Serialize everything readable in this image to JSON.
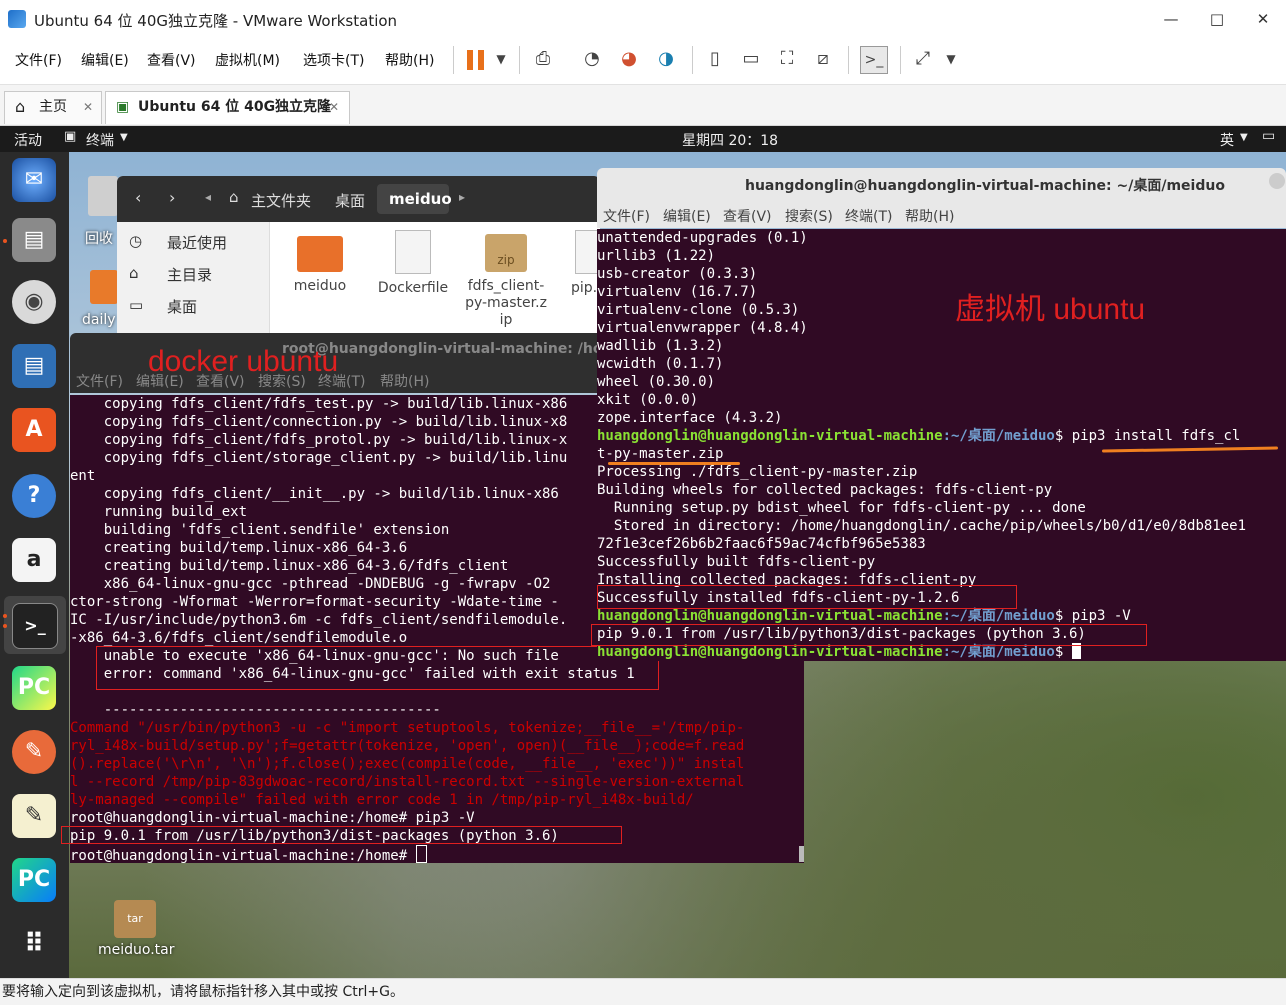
{
  "window": {
    "title": "Ubuntu 64 位 40G独立克隆 - VMware Workstation",
    "controls": [
      "—",
      "□",
      "✕"
    ]
  },
  "menubar": [
    "文件(F)",
    "编辑(E)",
    "查看(V)",
    "虚拟机(M)",
    "选项卡(T)",
    "帮助(H)"
  ],
  "tabs": [
    {
      "label": "主页"
    },
    {
      "label": "Ubuntu 64 位 40G独立克隆"
    }
  ],
  "ubuntu_topbar": {
    "activities": "活动",
    "app": "终端",
    "clock": "星期四 20：18",
    "ime": "英"
  },
  "desktop_icons": {
    "trash": "回收",
    "daily": "daily",
    "tar": "meiduo.tar"
  },
  "file_manager": {
    "path": [
      "主文件夹",
      "桌面",
      "meiduo"
    ],
    "sidebar": [
      "最近使用",
      "主目录",
      "桌面"
    ],
    "files": [
      {
        "name": "meiduo",
        "icon": "folder-icon"
      },
      {
        "name": "Dockerfile",
        "icon": "text-file-icon"
      },
      {
        "name": "fdfs_client-py-master.zip",
        "icon": "zip-icon",
        "icon_label": "zip"
      },
      {
        "name": "pip.",
        "icon": "file-icon"
      }
    ]
  },
  "term_left": {
    "title": "root@huangdonglin-virtual-machine: /home",
    "menu": [
      "文件(F)",
      "编辑(E)",
      "查看(V)",
      "搜索(S)",
      "终端(T)",
      "帮助(H)"
    ],
    "annotation": "docker ubuntu",
    "lines": [
      {
        "text": "    copying fdfs_client/fdfs_test.py -> build/lib.linux-x86",
        "cls": ""
      },
      {
        "text": "    copying fdfs_client/connection.py -> build/lib.linux-x8",
        "cls": ""
      },
      {
        "text": "    copying fdfs_client/fdfs_protol.py -> build/lib.linux-x",
        "cls": ""
      },
      {
        "text": "    copying fdfs_client/storage_client.py -> build/lib.linu",
        "cls": ""
      },
      {
        "text": "ent",
        "cls": ""
      },
      {
        "text": "    copying fdfs_client/__init__.py -> build/lib.linux-x86",
        "cls": ""
      },
      {
        "text": "    running build_ext",
        "cls": ""
      },
      {
        "text": "    building 'fdfs_client.sendfile' extension",
        "cls": ""
      },
      {
        "text": "    creating build/temp.linux-x86_64-3.6",
        "cls": ""
      },
      {
        "text": "    creating build/temp.linux-x86_64-3.6/fdfs_client",
        "cls": ""
      },
      {
        "text": "    x86_64-linux-gnu-gcc -pthread -DNDEBUG -g -fwrapv -O2",
        "cls": ""
      },
      {
        "text": "ctor-strong -Wformat -Werror=format-security -Wdate-time -",
        "cls": ""
      },
      {
        "text": "IC -I/usr/include/python3.6m -c fdfs_client/sendfilemodule.",
        "cls": ""
      },
      {
        "text": "-x86_64-3.6/fdfs_client/sendfilemodule.o",
        "cls": ""
      },
      {
        "text": "    unable to execute 'x86_64-linux-gnu-gcc': No such file",
        "cls": ""
      },
      {
        "text": "    error: command 'x86_64-linux-gnu-gcc' failed with exit status 1",
        "cls": ""
      },
      {
        "text": "",
        "cls": ""
      },
      {
        "text": "    ----------------------------------------",
        "cls": ""
      },
      {
        "text": "Command \"/usr/bin/python3 -u -c \"import setuptools, tokenize;__file__='/tmp/pip-",
        "cls": "red"
      },
      {
        "text": "ryl_i48x-build/setup.py';f=getattr(tokenize, 'open', open)(__file__);code=f.read",
        "cls": "red"
      },
      {
        "text": "().replace('\\r\\n', '\\n');f.close();exec(compile(code, __file__, 'exec'))\" instal",
        "cls": "red"
      },
      {
        "text": "l --record /tmp/pip-83gdwoac-record/install-record.txt --single-version-external",
        "cls": "red"
      },
      {
        "text": "ly-managed --compile\" failed with error code 1 in /tmp/pip-ryl_i48x-build/",
        "cls": "red"
      },
      {
        "text": "root@huangdonglin-virtual-machine:/home# pip3 -V",
        "cls": ""
      },
      {
        "text": "pip 9.0.1 from /usr/lib/python3/dist-packages (python 3.6)",
        "cls": ""
      },
      {
        "text": "root@huangdonglin-virtual-machine:/home# ",
        "cls": ""
      }
    ]
  },
  "term_right": {
    "title": "huangdonglin@huangdonglin-virtual-machine: ~/桌面/meiduo",
    "menu": [
      "文件(F)",
      "编辑(E)",
      "查看(V)",
      "搜索(S)",
      "终端(T)",
      "帮助(H)"
    ],
    "annotation": "虚拟机 ubuntu",
    "prompt_user": "huangdonglin@huangdonglin-virtual-machine",
    "prompt_path": ":~/桌面/meiduo",
    "lines": [
      {
        "text": "unattended-upgrades (0.1)"
      },
      {
        "text": "urllib3 (1.22)"
      },
      {
        "text": "usb-creator (0.3.3)"
      },
      {
        "text": "virtualenv (16.7.7)"
      },
      {
        "text": "virtualenv-clone (0.5.3)"
      },
      {
        "text": "virtualenvwrapper (4.8.4)"
      },
      {
        "text": "wadllib (1.3.2)"
      },
      {
        "text": "wcwidth (0.1.7)"
      },
      {
        "text": "wheel (0.30.0)"
      },
      {
        "text": "xkit (0.0.0)"
      },
      {
        "text": "zope.interface (4.3.2)"
      },
      {
        "prompt": true,
        "cmd": "$ pip3 install fdfs_cl"
      },
      {
        "text": "t-py-master.zip"
      },
      {
        "text": "Processing ./fdfs_client-py-master.zip"
      },
      {
        "text": "Building wheels for collected packages: fdfs-client-py"
      },
      {
        "text": "  Running setup.py bdist_wheel for fdfs-client-py ... done"
      },
      {
        "text": "  Stored in directory: /home/huangdonglin/.cache/pip/wheels/b0/d1/e0/8db81ee1"
      },
      {
        "text": "72f1e3cef26b6b2faac6f59ac74cfbf965e5383"
      },
      {
        "text": "Successfully built fdfs-client-py"
      },
      {
        "text": "Installing collected packages: fdfs-client-py"
      },
      {
        "text": "Successfully installed fdfs-client-py-1.2.6"
      },
      {
        "prompt": true,
        "cmd": "$ pip3 -V"
      },
      {
        "text": "pip 9.0.1 from /usr/lib/python3/dist-packages (python 3.6)"
      },
      {
        "prompt": true,
        "cmd": "$ "
      }
    ]
  },
  "statusbar": "要将输入定向到该虚拟机，请将鼠标指针移入其中或按 Ctrl+G。",
  "colors": {
    "terminal_bg": "#300a24",
    "prompt_green": "#8ae234",
    "path_blue": "#729fcf",
    "annotation_red": "#e02020",
    "underline_orange": "#f08020"
  }
}
